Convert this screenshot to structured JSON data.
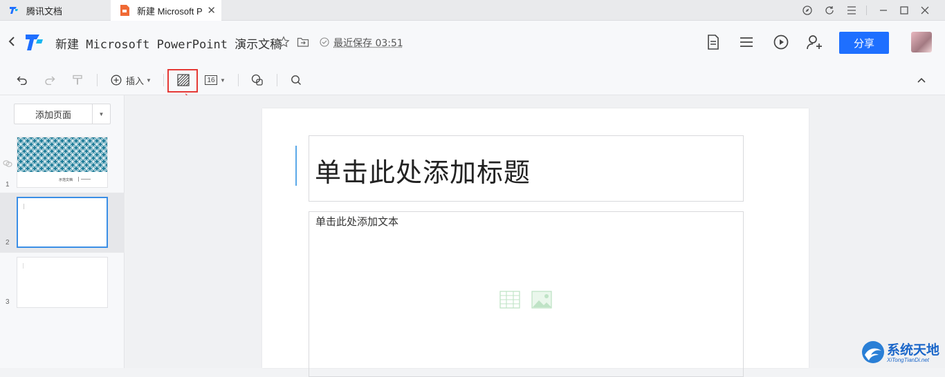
{
  "tabs": [
    {
      "label": "腾讯文档"
    },
    {
      "label": "新建 Microsoft P"
    }
  ],
  "header": {
    "title": "新建 Microsoft PowerPoint 演示文稿",
    "save_status": "最近保存 03:51",
    "share_label": "分享"
  },
  "toolbar": {
    "insert_label": "插入",
    "font_size": "16"
  },
  "sidebar": {
    "add_page_label": "添加页面",
    "slides": [
      {
        "number": "1",
        "caption": "示范文档"
      },
      {
        "number": "2"
      },
      {
        "number": "3"
      }
    ]
  },
  "slide": {
    "title_placeholder": "单击此处添加标题",
    "body_placeholder": "单击此处添加文本"
  },
  "watermark": {
    "main": "系统天地",
    "sub": "XiTongTianDi.net"
  },
  "colors": {
    "accent": "#1e6fff",
    "highlight": "#e53935",
    "thumb_pattern": "#1f7d99"
  }
}
